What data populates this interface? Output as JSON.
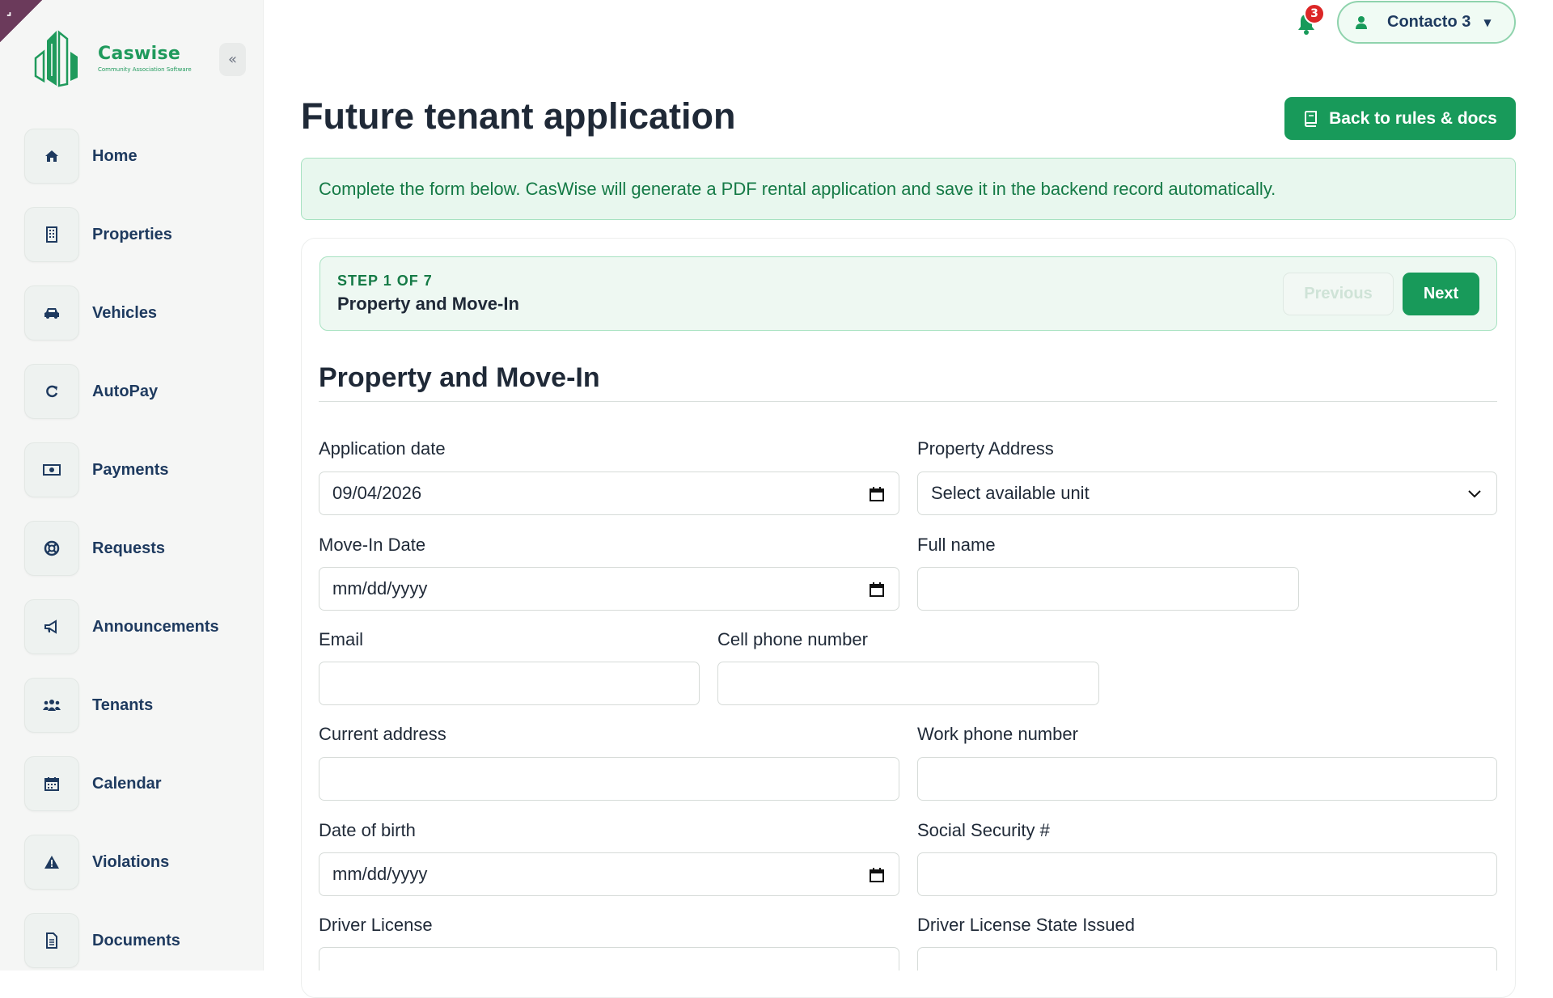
{
  "sidebar": {
    "brand": "Caswise",
    "brand_sub": "Community Association Software",
    "items": [
      {
        "label": "Home",
        "icon": "home-icon"
      },
      {
        "label": "Properties",
        "icon": "building-icon"
      },
      {
        "label": "Vehicles",
        "icon": "car-icon"
      },
      {
        "label": "AutoPay",
        "icon": "refresh-icon"
      },
      {
        "label": "Payments",
        "icon": "money-icon"
      },
      {
        "label": "Requests",
        "icon": "lifebuoy-icon"
      },
      {
        "label": "Announcements",
        "icon": "megaphone-icon"
      },
      {
        "label": "Tenants",
        "icon": "users-icon"
      },
      {
        "label": "Calendar",
        "icon": "calendar-icon"
      },
      {
        "label": "Violations",
        "icon": "warning-icon"
      },
      {
        "label": "Documents",
        "icon": "document-icon"
      }
    ]
  },
  "topbar": {
    "notifications_count": "3",
    "user_name": "Contacto 3"
  },
  "page": {
    "title": "Future tenant application",
    "back_button": "Back to rules & docs",
    "banner": "Complete the form below. CasWise will generate a PDF rental application and save it in the backend record automatically."
  },
  "stepper": {
    "kicker": "STEP 1 OF 7",
    "title": "Property and Move-In",
    "previous_label": "Previous",
    "next_label": "Next"
  },
  "form": {
    "section_title": "Property and Move-In",
    "application_date": {
      "label": "Application date",
      "value": "09/04/2026"
    },
    "property_address": {
      "label": "Property Address",
      "value": "Select available unit"
    },
    "move_in_date": {
      "label": "Move-In Date",
      "value": "mm/dd/yyyy"
    },
    "full_name": {
      "label": "Full name",
      "value": ""
    },
    "email": {
      "label": "Email",
      "value": ""
    },
    "cell_phone": {
      "label": "Cell phone number",
      "value": ""
    },
    "current_address": {
      "label": "Current address",
      "value": ""
    },
    "work_phone": {
      "label": "Work phone number",
      "value": ""
    },
    "date_of_birth": {
      "label": "Date of birth",
      "value": "mm/dd/yyyy"
    },
    "ssn": {
      "label": "Social Security #",
      "value": ""
    },
    "driver_license": {
      "label": "Driver License",
      "value": ""
    },
    "dl_state": {
      "label": "Driver License State Issued",
      "value": ""
    }
  },
  "colors": {
    "accent": "#189a5a",
    "navy": "#1e3a5f",
    "badge": "#dc2626"
  }
}
